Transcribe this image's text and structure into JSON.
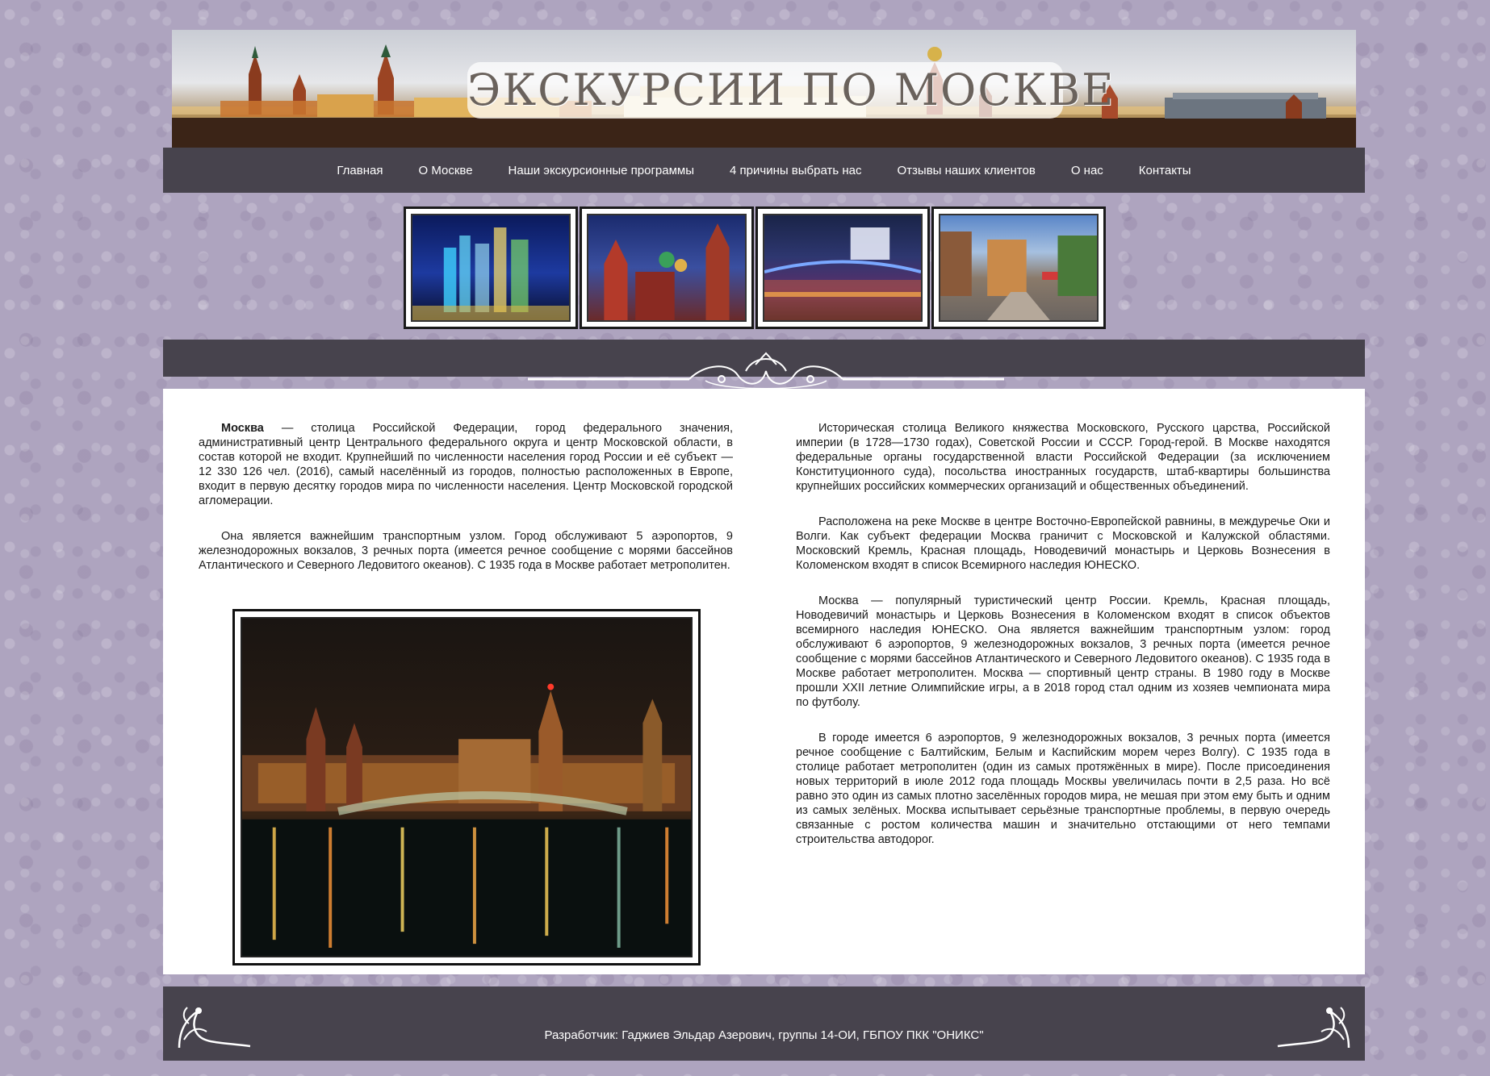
{
  "header": {
    "title": "ЭКСКУРСИИ ПО МОСКВЕ"
  },
  "nav": {
    "items": [
      {
        "label": "Главная"
      },
      {
        "label": "О Москве"
      },
      {
        "label": "Наши экскурсионные программы"
      },
      {
        "label": "4 причины выбрать нас"
      },
      {
        "label": "Отзывы наших клиентов"
      },
      {
        "label": "О нас"
      },
      {
        "label": "Контакты"
      }
    ]
  },
  "gallery": {
    "thumbnails": [
      {
        "subject": "moscow-city-skyscrapers"
      },
      {
        "subject": "red-square-st-basils"
      },
      {
        "subject": "moskva-river-bridge-night"
      },
      {
        "subject": "arbat-street"
      }
    ]
  },
  "content": {
    "left": {
      "p1_bold": "Москва",
      "p1_rest": " — столица Российской Федерации, город федерального значения, административный центр Центрального федерального округа и центр Московской области, в состав которой не входит. Крупнейший по численности населения город России и её субъект — 12 330 126 чел. (2016), самый населённый из городов, полностью расположенных в Европе, входит в первую десятку городов мира по численности населения. Центр Московской городской агломерации.",
      "p2": "Она является важнейшим транспортным узлом. Город обслуживают 5 аэропортов, 9 железнодорожных вокзалов, 3 речных порта (имеется речное сообщение с морями бассейнов Атлантического и Северного Ледовитого океанов). С 1935 года в Москве работает метрополитен."
    },
    "right": {
      "p1": "Историческая столица Великого княжества Московского, Русского царства, Российской империи (в 1728—1730 годах), Советской России и СССР. Город-герой. В Москве находятся федеральные органы государственной власти Российской Федерации (за исключением Конституционного суда), посольства иностранных государств, штаб-квартиры большинства крупнейших российских коммерческих организаций и общественных объединений.",
      "p2": "Расположена на реке Москве в центре Восточно-Европейской равнины, в междуречье Оки и Волги. Как субъект федерации Москва граничит с Московской и Калужской областями. Московский Кремль, Красная площадь, Новодевичий монастырь и Церковь Вознесения в Коломенском входят в список Всемирного наследия ЮНЕСКО.",
      "p3": "Москва — популярный туристический центр России. Кремль, Красная площадь, Новодевичий монастырь и Церковь Вознесения в Коломенском входят в список объектов всемирного наследия ЮНЕСКО. Она является важнейшим транспортным узлом: город обслуживают 6 аэропортов, 9 железнодорожных вокзалов, 3 речных порта (имеется речное сообщение с морями бассейнов Атлантического и Северного Ледовитого океанов). С 1935 года в Москве работает метрополитен. Москва — спортивный центр страны. В 1980 году в Москве прошли XXII летние Олимпийские игры, а в 2018 город стал одним из хозяев чемпионата мира по футболу.",
      "p4": "В городе имеется 6 аэропортов, 9 железнодорожных вокзалов, 3 речных порта (имеется речное сообщение с Балтийским, Белым и Каспийским морем через Волгу). С 1935 года в столице работает метрополитен (один из самых протяжённых в мире). После присоединения новых территорий в июле 2012 года площадь Москвы увеличилась почти в 2,5 раза. Но всё равно это один из самых плотно заселённых городов мира, не мешая при этом ему быть и одним из самых зелёных. Москва испытывает серьёзные транспортные проблемы, в первую очередь связанные с ростом количества машин и значительно отстающими от него темпами строительства автодорог."
    }
  },
  "footer": {
    "credit": "Разработчик: Гаджиев Эльдар Азерович, группы 14-ОИ, ГБПОУ ПКК \"ОНИКС\""
  },
  "colors": {
    "page_bg": "#aea4bf",
    "bar": "#47434d",
    "content_bg": "#ffffff"
  }
}
